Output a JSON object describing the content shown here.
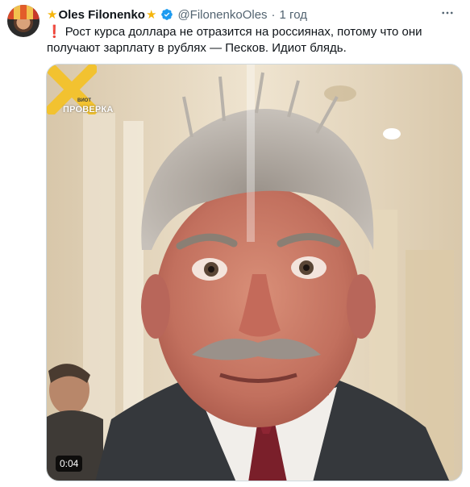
{
  "tweet": {
    "author_name": "Oles Filonenko",
    "handle": "@FilonenkoOles",
    "separator": "·",
    "timestamp": "1 год",
    "text": "Рост курса доллара не отразится на россиянах, потому что они получают зарплату в рублях — Песков. Идиот блядь."
  },
  "media": {
    "duration": "0:04",
    "watermark_logo": "ПРОВЕРКА",
    "watermark_small": "ВИОТ"
  },
  "icons": {
    "name_prefix": "star-icon",
    "name_suffix": "star-icon",
    "verified": "verified-badge-icon",
    "more": "more-options-icon",
    "alert": "exclamation-icon"
  },
  "colors": {
    "accent_blue": "#1d9bf0",
    "star": "#f5b50c",
    "secondary_text": "#536471",
    "alert_red": "#d81e2c"
  }
}
